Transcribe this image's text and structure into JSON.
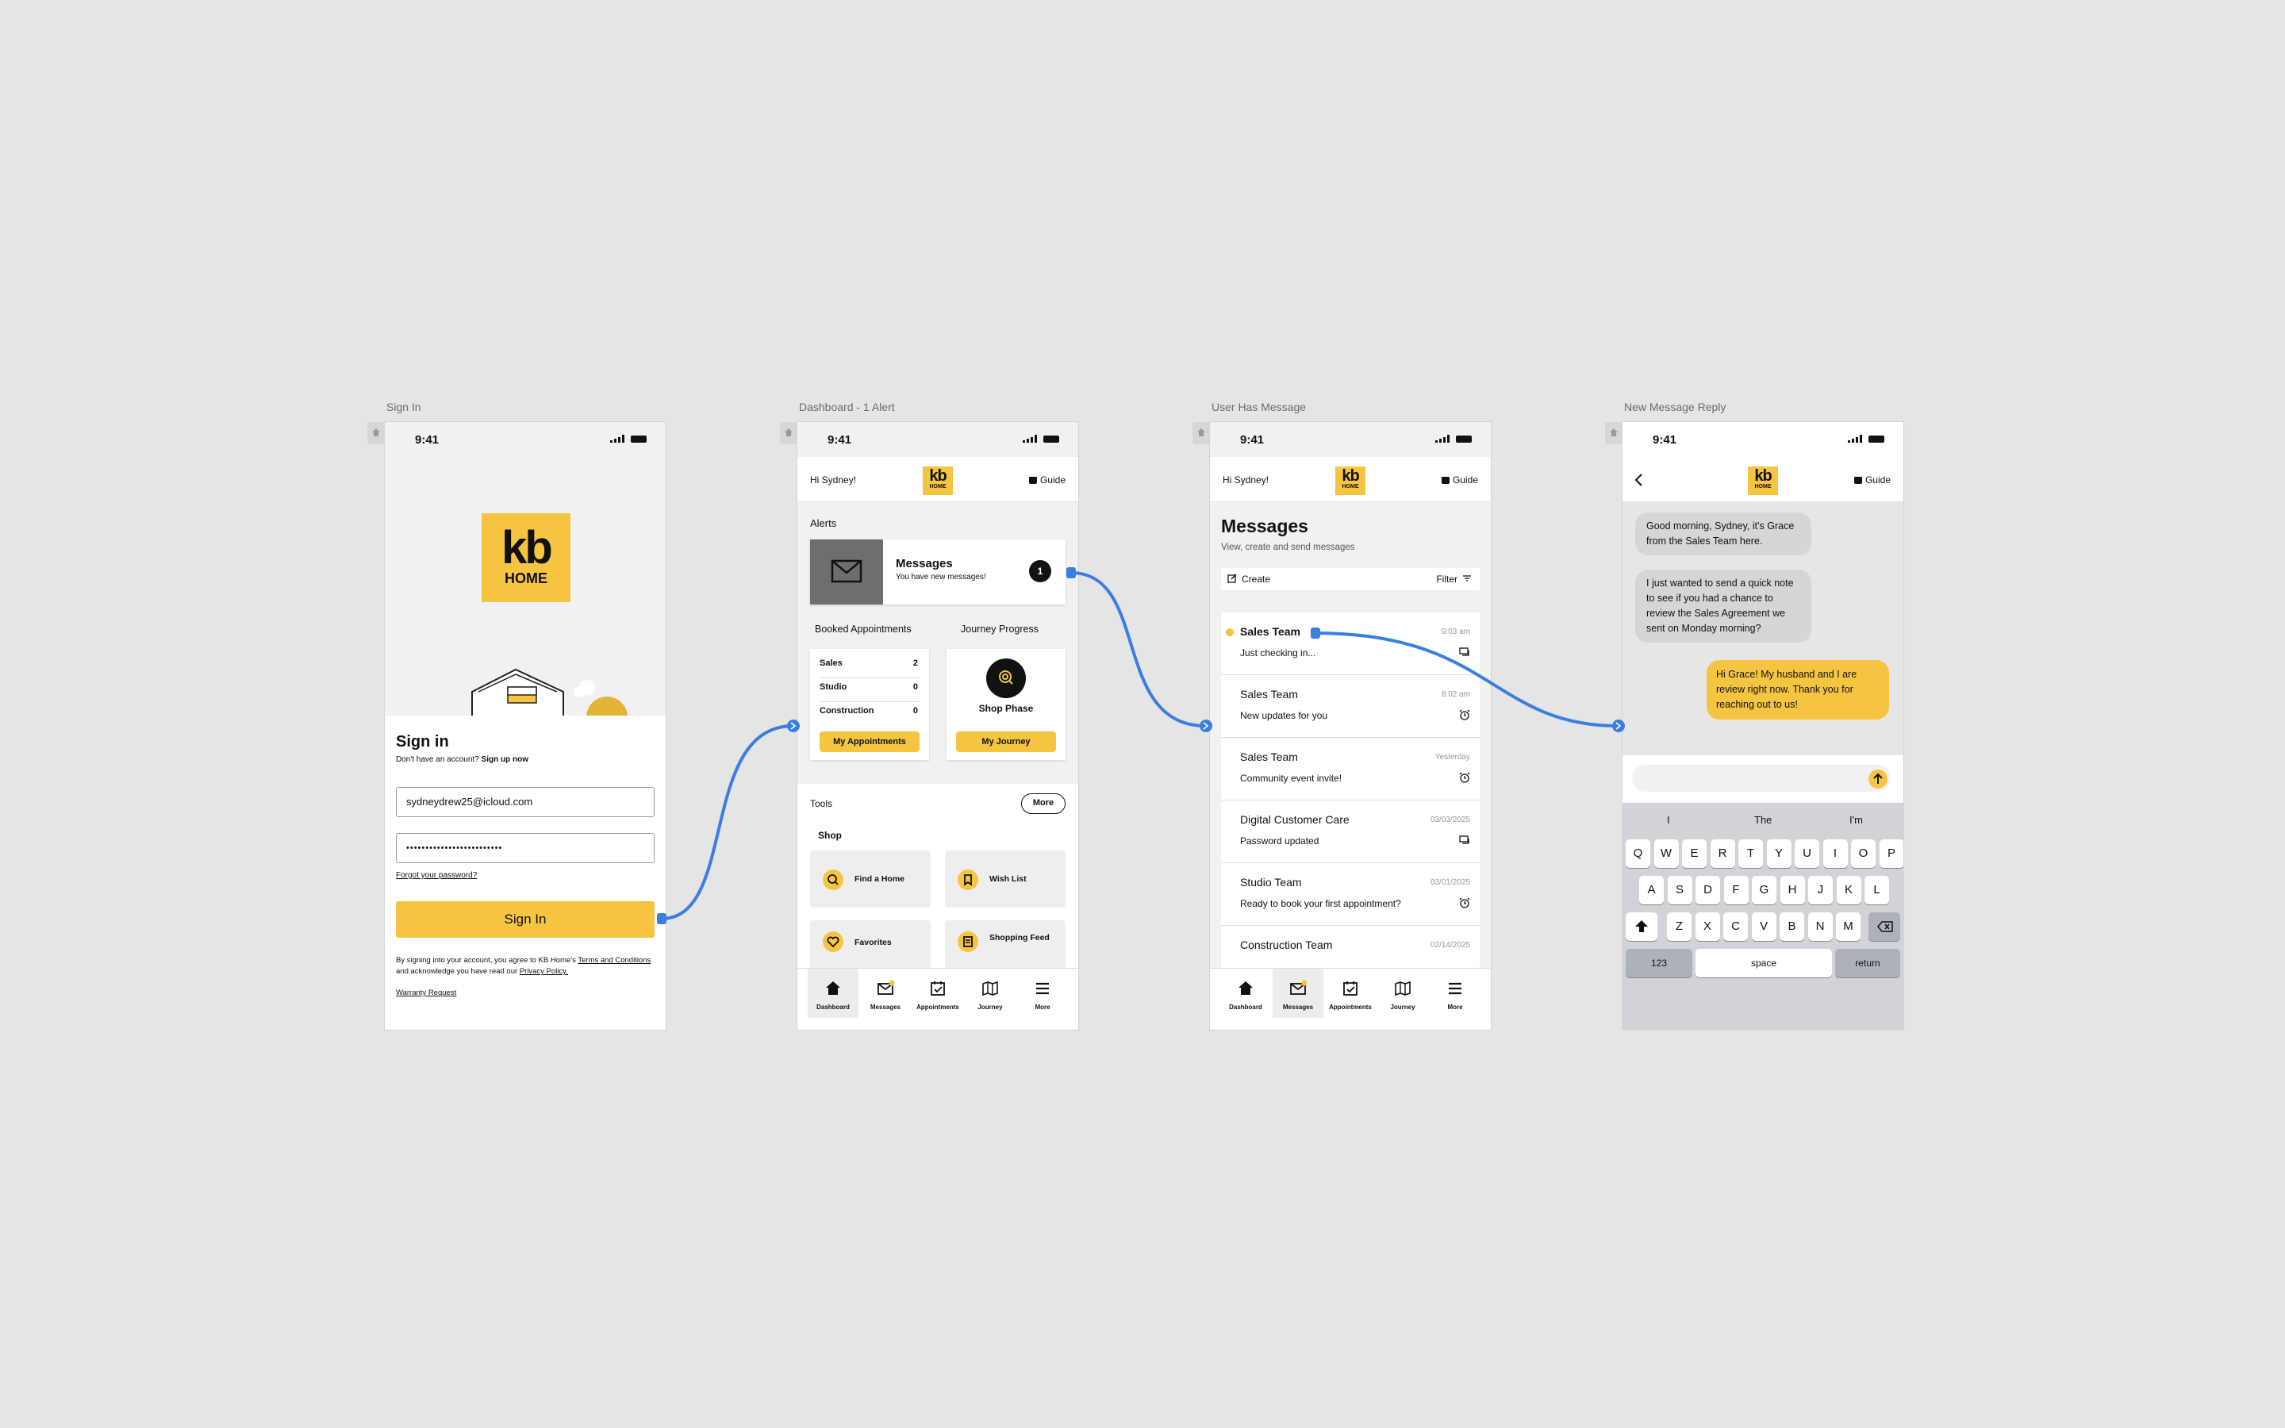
{
  "frames": [
    {
      "label": "Sign In"
    },
    {
      "label": "Dashboard - 1 Alert"
    },
    {
      "label": "User Has Message"
    },
    {
      "label": "New Message Reply"
    }
  ],
  "status": {
    "time": "9:41"
  },
  "header": {
    "greeting": "Hi Sydney!",
    "logo_kb": "kb",
    "logo_home": "HOME",
    "guide": "Guide"
  },
  "signin": {
    "logo_kb": "kb",
    "logo_home": "HOME",
    "title": "Sign in",
    "no_account": "Don't have an account?",
    "signup": "Sign up now",
    "email_value": "sydneydrew25@icloud.com",
    "password_value": "•••••••••••••••••••••••••",
    "forgot": "Forgot your password?",
    "button": "Sign In",
    "terms_prefix": "By signing into your account, you agree to KB Home’s ",
    "terms_link": "Terms and Conditions",
    "terms_mid": " and acknowledge you have read our ",
    "privacy_link": "Privacy Policy.",
    "warranty": "Warranty Request"
  },
  "dashboard": {
    "alerts_title": "Alerts",
    "alert_title": "Messages",
    "alert_sub": "You have new messages!",
    "alert_count": "1",
    "booked_title": "Booked Appointments",
    "journey_title": "Journey Progress",
    "appointments": [
      {
        "label": "Sales",
        "count": "2"
      },
      {
        "label": "Studio",
        "count": "0"
      },
      {
        "label": "Construction",
        "count": "0"
      }
    ],
    "my_appointments": "My Appointments",
    "phase": "Shop Phase",
    "my_journey": "My Journey",
    "tools_title": "Tools",
    "more": "More",
    "shop_title": "Shop",
    "tools": [
      {
        "label": "Find a Home",
        "icon": "search-icon"
      },
      {
        "label": "Wish List",
        "icon": "bookmark-icon"
      },
      {
        "label": "Favorites",
        "icon": "heart-icon"
      },
      {
        "label": "Shopping Feed",
        "icon": "feed-icon"
      }
    ]
  },
  "tabs": [
    "Dashboard",
    "Messages",
    "Appointments",
    "Journey",
    "More"
  ],
  "messages": {
    "title": "Messages",
    "subtitle": "View, create and send messages",
    "create": "Create",
    "filter": "Filter",
    "items": [
      {
        "sender": "Sales Team",
        "preview": "Just checking in...",
        "time": "9:03 am",
        "unread": true,
        "icon": "chat-icon"
      },
      {
        "sender": "Sales Team",
        "preview": "New updates for you",
        "time": "8:02 am",
        "unread": false,
        "icon": "alarm-icon"
      },
      {
        "sender": "Sales Team",
        "preview": "Community event invite!",
        "time": "Yesterday",
        "unread": false,
        "icon": "alarm-icon"
      },
      {
        "sender": "Digital Customer Care",
        "preview": "Password updated",
        "time": "03/03/2025",
        "unread": false,
        "icon": "chat-icon"
      },
      {
        "sender": "Studio Team",
        "preview": "Ready to book your first appointment?",
        "time": "03/01/2025",
        "unread": false,
        "icon": "alarm-icon"
      },
      {
        "sender": "Construction Team",
        "preview": "",
        "time": "02/14/2025",
        "unread": false,
        "icon": "chat-icon"
      }
    ]
  },
  "chat": {
    "guide": "Guide",
    "bubbles": [
      {
        "text": "Good morning, Sydney, it's Grace from the Sales Team here.",
        "from": "them"
      },
      {
        "text": "I just wanted to send a quick note to see if you had a chance to review the Sales Agreement we sent on Monday morning?",
        "from": "them"
      },
      {
        "text": "Hi Grace! My husband and I are review right now. Thank you for reaching out to us!",
        "from": "me"
      }
    ],
    "suggestions": [
      "I",
      "The",
      "I'm"
    ],
    "row1": [
      "Q",
      "W",
      "E",
      "R",
      "T",
      "Y",
      "U",
      "I",
      "O",
      "P"
    ],
    "row2": [
      "A",
      "S",
      "D",
      "F",
      "G",
      "H",
      "J",
      "K",
      "L"
    ],
    "row3": [
      "Z",
      "X",
      "C",
      "V",
      "B",
      "N",
      "M"
    ],
    "key_123": "123",
    "key_space": "space",
    "key_return": "return"
  },
  "colors": {
    "accent": "#f5c542",
    "connector": "#3b7de0",
    "background": "#e5e5e5"
  }
}
